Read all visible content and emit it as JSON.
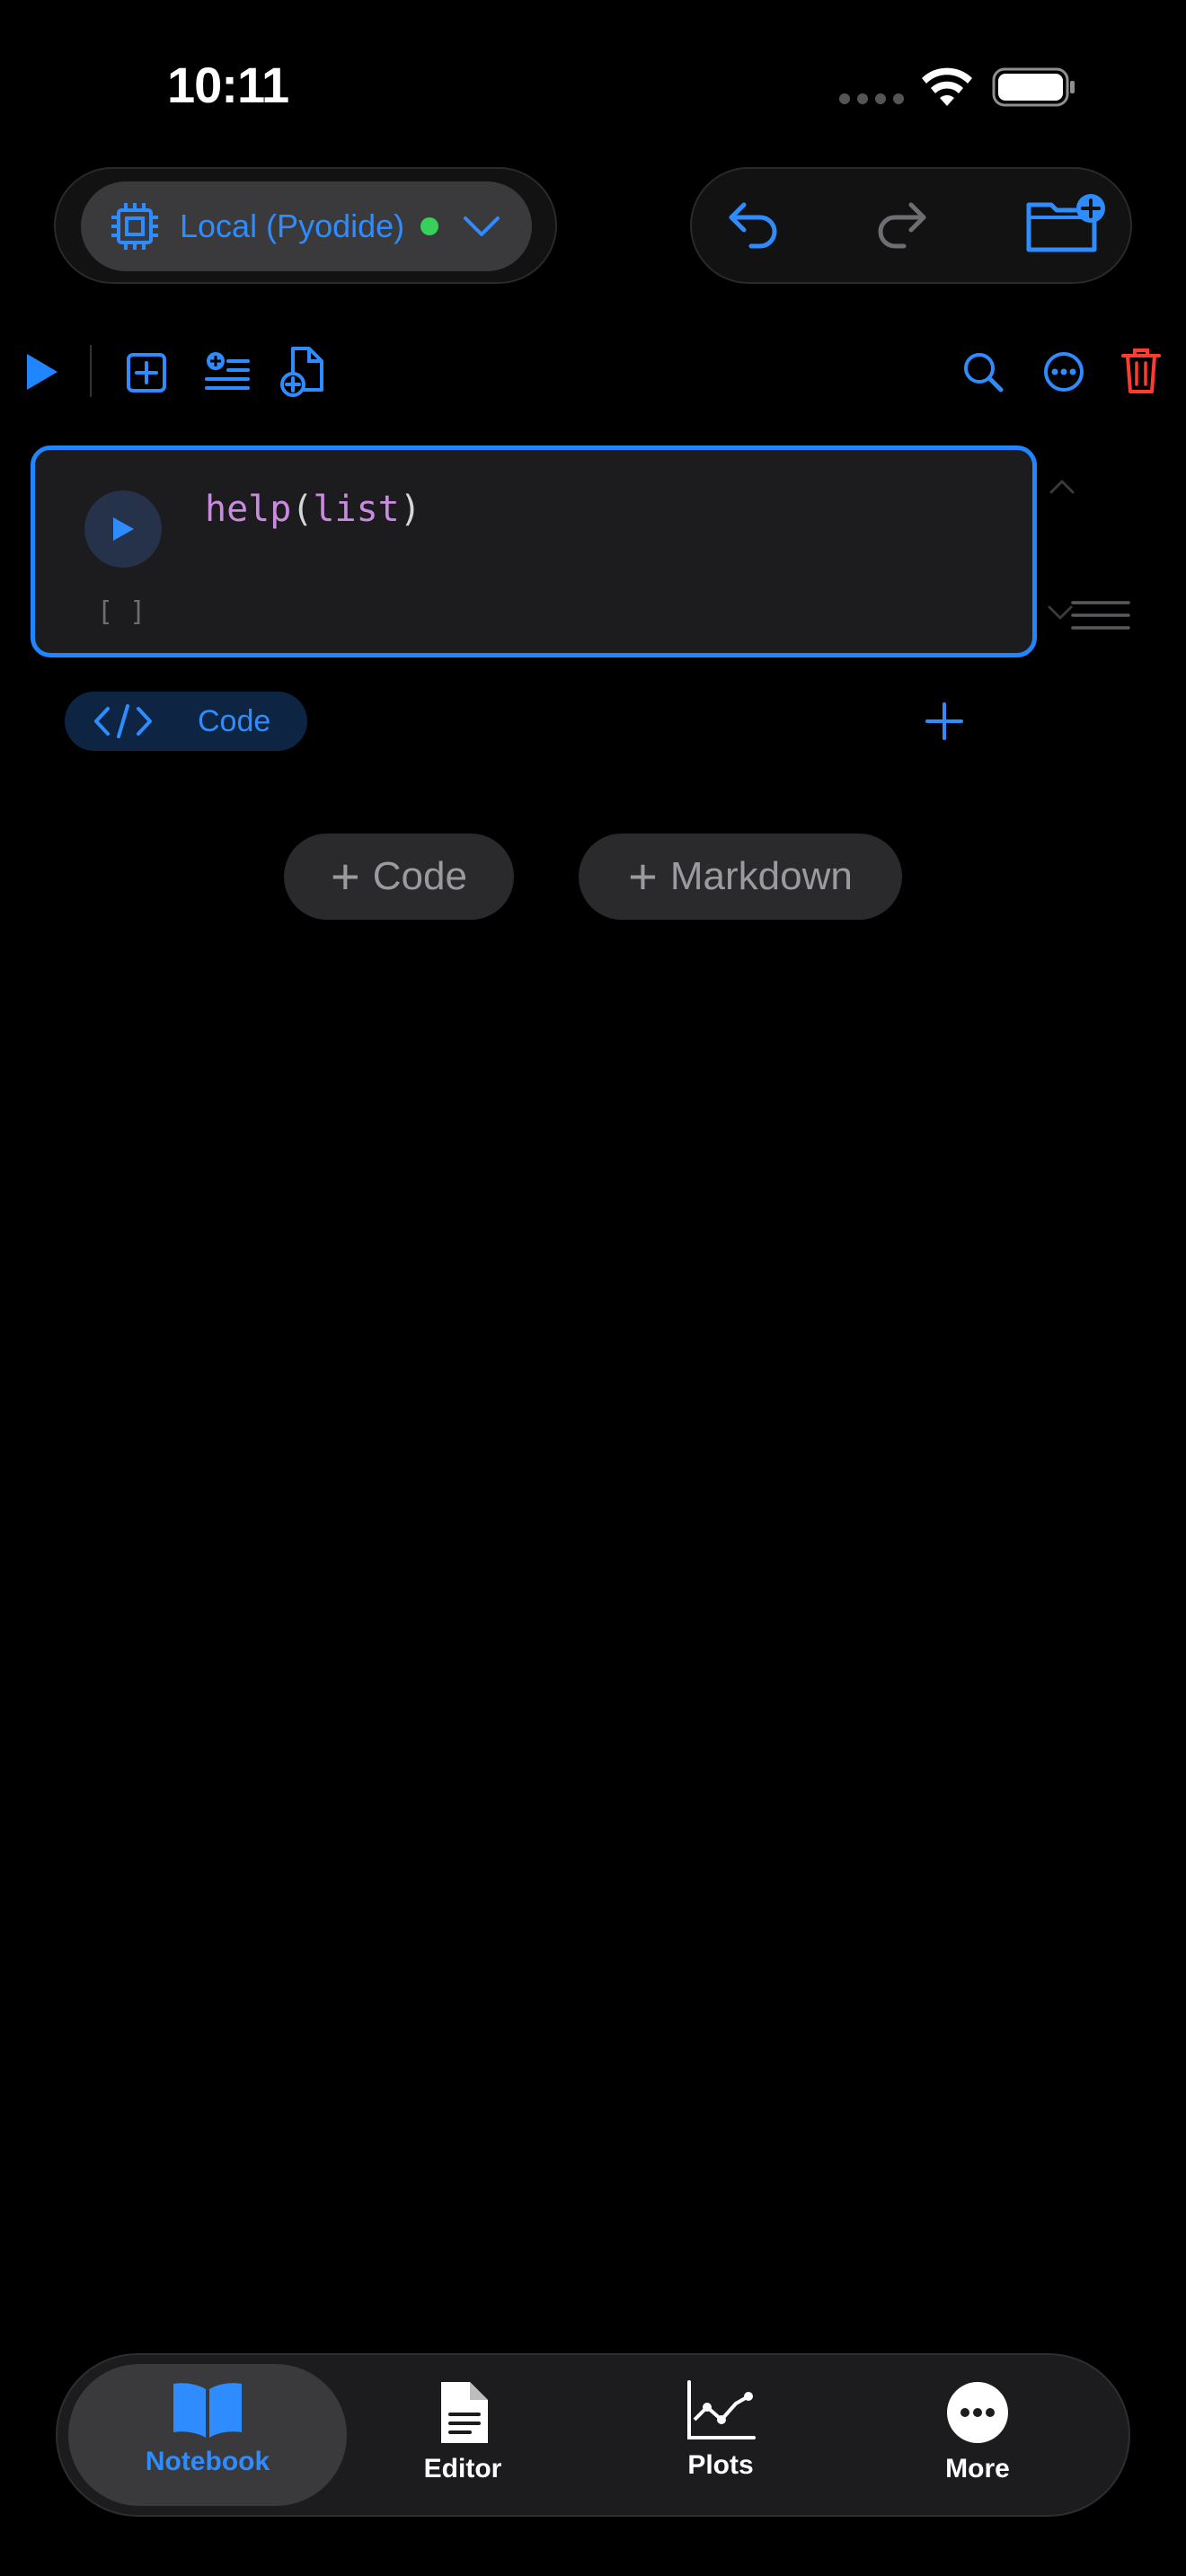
{
  "status_bar": {
    "time": "10:11"
  },
  "runtime": {
    "label": "Local (Pyodide)",
    "status_color": "#35d15a",
    "icon": "cpu-chip-icon"
  },
  "history": {
    "undo_icon": "undo-arrow-icon",
    "redo_icon": "redo-arrow-icon",
    "new_folder_icon": "folder-plus-icon"
  },
  "toolbar": {
    "left_icons": [
      "run-all-icon",
      "add-cell-icon",
      "insert-list-icon",
      "new-document-icon"
    ],
    "right_icons": [
      "search-icon",
      "more-ellipsis-icon",
      "trash-icon"
    ]
  },
  "cell": {
    "code_func": "help",
    "code_open": "(",
    "code_arg": "list",
    "code_close": ")",
    "exec_count": "[ ]",
    "type_label": "Code"
  },
  "add_buttons": {
    "code_label": "Code",
    "markdown_label": "Markdown"
  },
  "tabbar": {
    "tabs": [
      {
        "label": "Notebook",
        "icon": "book-icon",
        "active": true
      },
      {
        "label": "Editor",
        "icon": "document-icon",
        "active": false
      },
      {
        "label": "Plots",
        "icon": "line-chart-icon",
        "active": false
      },
      {
        "label": "More",
        "icon": "ellipsis-circle-icon",
        "active": false
      }
    ]
  },
  "colors": {
    "accent": "#2f8cff",
    "danger": "#ff3b30",
    "background": "#000000",
    "code_keyword": "#c98ae0"
  }
}
